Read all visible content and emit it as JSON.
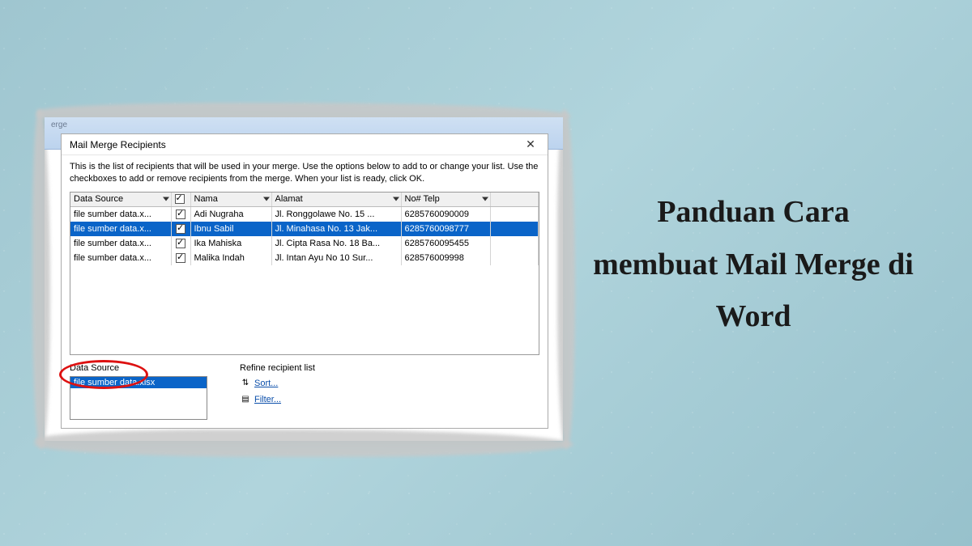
{
  "side_title": "Panduan Cara membuat Mail Merge di Word",
  "word_tag": "erge",
  "dialog": {
    "title": "Mail Merge Recipients",
    "instructions": "This is the list of recipients that will be used in your merge.  Use the options below to add to or change your list.  Use the checkboxes to add or remove recipients from the merge.  When your list is ready, click OK.",
    "columns": {
      "data_source": "Data Source",
      "nama": "Nama",
      "alamat": "Alamat",
      "telp": "No# Telp"
    },
    "rows": [
      {
        "ds": "file sumber data.x...",
        "checked": true,
        "nama": "Adi Nugraha",
        "alamat": "Jl. Ronggolawe No. 15 ...",
        "telp": "6285760090009",
        "selected": false
      },
      {
        "ds": "file sumber data.x...",
        "checked": true,
        "nama": "Ibnu Sabil",
        "alamat": "Jl. Minahasa No. 13 Jak...",
        "telp": "6285760098777",
        "selected": true
      },
      {
        "ds": "file sumber data.x...",
        "checked": true,
        "nama": "Ika Mahiska",
        "alamat": "Jl. Cipta Rasa No. 18 Ba...",
        "telp": "6285760095455",
        "selected": false
      },
      {
        "ds": "file sumber data.x...",
        "checked": true,
        "nama": "Malika Indah",
        "alamat": "Jl. Intan Ayu No 10 Sur...",
        "telp": "628576009998",
        "selected": false
      }
    ],
    "lower": {
      "data_source_label": "Data Source",
      "data_source_file": "file sumber data.xlsx",
      "refine_label": "Refine recipient list",
      "sort": "Sort...",
      "filter": "Filter..."
    }
  }
}
